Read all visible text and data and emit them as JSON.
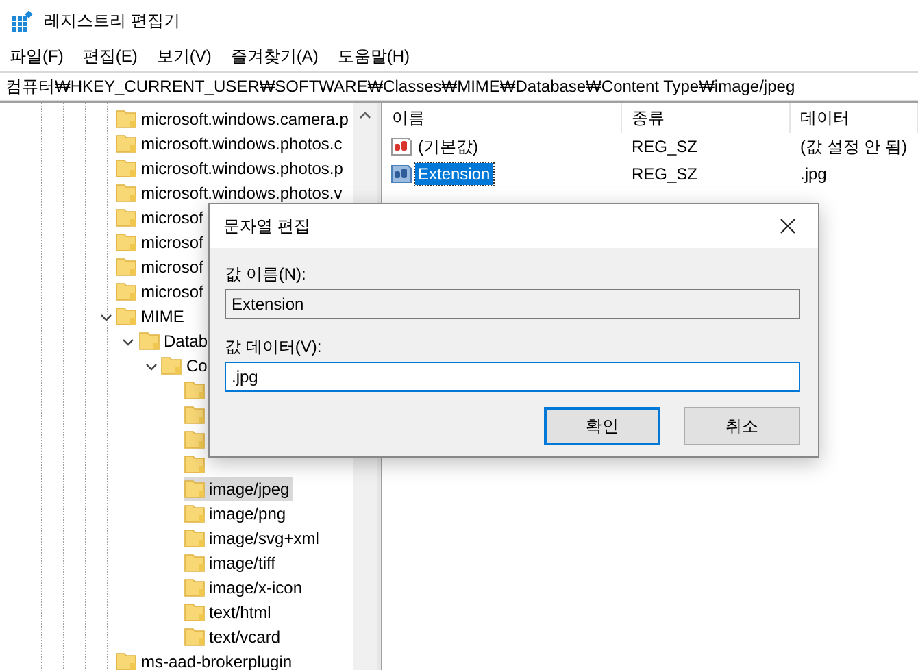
{
  "window": {
    "title": "레지스트리 편집기"
  },
  "menu": [
    "파일(F)",
    "편집(E)",
    "보기(V)",
    "즐겨찾기(A)",
    "도움말(H)"
  ],
  "address_bar": {
    "value": "컴퓨터₩HKEY_CURRENT_USER₩SOFTWARE₩Classes₩MIME₩Database₩Content Type₩image/jpeg"
  },
  "tree": {
    "items": [
      {
        "label": "microsoft.windows.camera.p",
        "selected": false
      },
      {
        "label": "microsoft.windows.photos.c",
        "selected": false
      },
      {
        "label": "microsoft.windows.photos.p",
        "selected": false
      },
      {
        "label": "microsoft.windows.photos.v",
        "selected": false
      },
      {
        "label": "microsof",
        "selected": false
      },
      {
        "label": "microsof",
        "selected": false
      },
      {
        "label": "microsof",
        "selected": false
      },
      {
        "label": "microsof",
        "selected": false
      },
      {
        "label": "MIME",
        "selected": false,
        "expanded": true,
        "children": [
          {
            "label": "Datab",
            "selected": false,
            "expanded": true,
            "children": [
              {
                "label": "Co",
                "selected": false,
                "expanded": true,
                "children": [
                  {
                    "selected": false
                  },
                  {
                    "selected": false
                  },
                  {
                    "selected": false
                  },
                  {
                    "selected": false
                  },
                  {
                    "label": "image/jpeg",
                    "selected": true
                  },
                  {
                    "label": "image/png",
                    "selected": false
                  },
                  {
                    "label": "image/svg+xml",
                    "selected": false
                  },
                  {
                    "label": "image/tiff",
                    "selected": false
                  },
                  {
                    "label": "image/x-icon",
                    "selected": false
                  },
                  {
                    "label": "text/html",
                    "selected": false
                  },
                  {
                    "label": "text/vcard",
                    "selected": false
                  }
                ]
              }
            ]
          }
        ]
      },
      {
        "label": "ms-aad-brokerplugin",
        "selected": false
      }
    ]
  },
  "values_list": {
    "columns": [
      "이름",
      "종류",
      "데이터"
    ],
    "rows": [
      {
        "name": "(기본값)",
        "type": "REG_SZ",
        "data": "(값 설정 안 됨)",
        "selected": false
      },
      {
        "name": "Extension",
        "type": "REG_SZ",
        "data": ".jpg",
        "selected": true
      }
    ]
  },
  "dialog": {
    "title": "문자열 편집",
    "name_label": "값 이름(N):",
    "name_value": "Extension",
    "data_label": "값 데이터(V):",
    "data_value": ".jpg",
    "buttons": [
      {
        "label": "확인",
        "default": true
      },
      {
        "label": "취소",
        "default": false
      }
    ]
  }
}
